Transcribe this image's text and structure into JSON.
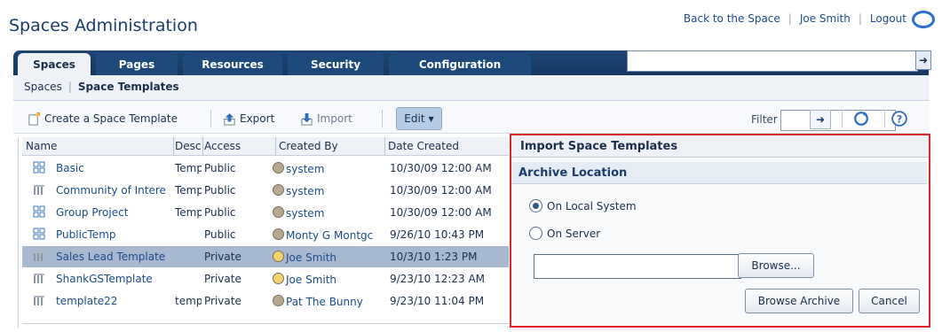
{
  "header": {
    "title": "Spaces Administration",
    "links": [
      "Back to the Space",
      "Joe Smith",
      "Logout"
    ]
  },
  "nav": {
    "tabs": [
      "Spaces",
      "Pages",
      "Resources",
      "Security",
      "Configuration"
    ],
    "active_tab": "Spaces",
    "search_value": ""
  },
  "breadcrumb": {
    "parent": "Spaces",
    "current": "Space Templates"
  },
  "toolbar": {
    "create": "Create a Space Template",
    "export": "Export",
    "import": "Import",
    "edit": "Edit",
    "filter_label": "Filter",
    "filter_value": ""
  },
  "table": {
    "columns": [
      "Name",
      "Desc",
      "Access",
      "Created By",
      "Date Created"
    ],
    "rows": [
      {
        "name": "Basic",
        "desc": "Temp",
        "access": "Public",
        "created_by": "system",
        "date": "10/30/09 12:00 AM",
        "icon": "template-grid-icon",
        "user_icon": "group-user-icon",
        "selected": false
      },
      {
        "name": "Community of Intere",
        "desc": "Temp",
        "access": "Public",
        "created_by": "system",
        "date": "10/30/09 12:00 AM",
        "icon": "template-bars-icon",
        "user_icon": "group-user-icon",
        "selected": false
      },
      {
        "name": "Group Project",
        "desc": "Temp",
        "access": "Public",
        "created_by": "system",
        "date": "10/30/09 12:00 AM",
        "icon": "template-grid-icon",
        "user_icon": "group-user-icon",
        "selected": false
      },
      {
        "name": "PublicTemp",
        "desc": "",
        "access": "Public",
        "created_by": "Monty G Montgc",
        "date": "9/26/10 10:43 PM",
        "icon": "template-grid-icon",
        "user_icon": "group-user-icon",
        "selected": false
      },
      {
        "name": "Sales Lead Template",
        "desc": "",
        "access": "Private",
        "created_by": "Joe Smith",
        "date": "10/3/10 1:23 PM",
        "icon": "template-bars-icon",
        "user_icon": "smiley-user-icon",
        "selected": true
      },
      {
        "name": "ShankGSTemplate",
        "desc": "",
        "access": "Private",
        "created_by": "Joe Smith",
        "date": "9/23/10 12:23 AM",
        "icon": "template-bars-icon",
        "user_icon": "smiley-user-icon",
        "selected": false
      },
      {
        "name": "template22",
        "desc": "temp",
        "access": "Private",
        "created_by": "Pat The Bunny",
        "date": "9/23/10 11:04 PM",
        "icon": "template-bars-icon",
        "user_icon": "group-user-icon",
        "selected": false
      }
    ]
  },
  "dialog": {
    "title": "Import Space Templates",
    "section": "Archive Location",
    "options": [
      "On Local System",
      "On Server"
    ],
    "selected_option": "On Local System",
    "file_value": "",
    "browse": "Browse...",
    "browse_archive": "Browse Archive",
    "cancel": "Cancel"
  },
  "colors": {
    "nav_bg": "#1f4574",
    "highlight_border": "#e0242c",
    "selected_row": "#a8b8cf"
  }
}
